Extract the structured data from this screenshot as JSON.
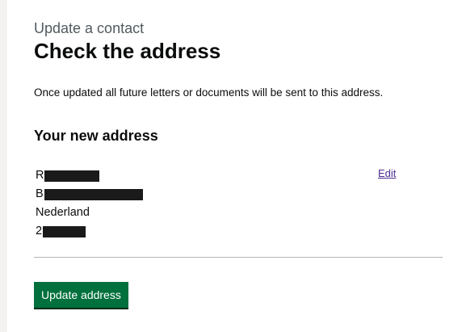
{
  "page": {
    "caption": "Update a contact",
    "title": "Check the address",
    "intro": "Once updated all future letters or documents will be sent to this address."
  },
  "address_section": {
    "heading": "Your new address",
    "edit_label": "Edit",
    "lines": [
      {
        "visible": "R",
        "redacted": true
      },
      {
        "visible": "B",
        "redacted": true
      },
      {
        "visible": "Nederland",
        "redacted": false
      },
      {
        "visible": "2",
        "redacted": true
      }
    ]
  },
  "actions": {
    "submit_label": "Update address"
  },
  "colors": {
    "button": "#00703c",
    "link": "#4c2c92",
    "text": "#0b0c0c",
    "caption": "#505a5f",
    "divider": "#b1b4b6"
  }
}
